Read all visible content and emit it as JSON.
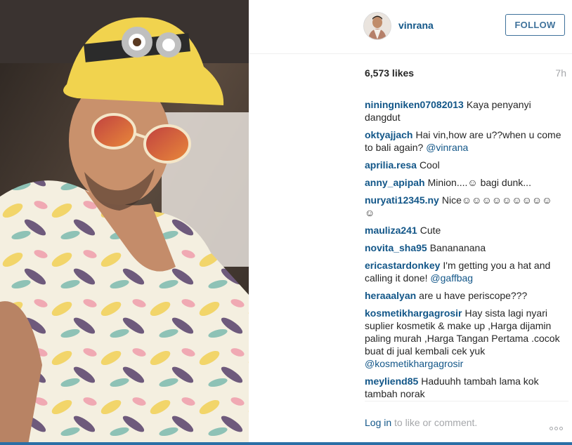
{
  "post": {
    "username": "vinrana",
    "follow_label": "FOLLOW",
    "likes": "6,573 likes",
    "time_ago": "7h",
    "photo_alt": "selfie"
  },
  "comments": [
    {
      "user": "niningniken07082013",
      "text": "Kaya penyanyi dangdut"
    },
    {
      "user": "oktyajjach",
      "text": "Hai vin,how are u??when u come to bali again?",
      "mention": "@vinrana"
    },
    {
      "user": "aprilia.resa",
      "text": "Cool"
    },
    {
      "user": "anny_apipah",
      "text": "Minion....☺ bagi dunk..."
    },
    {
      "user": "nuryati12345.ny",
      "text": "Nice☺☺☺☺☺☺☺☺☺ ☺"
    },
    {
      "user": "mauliza241",
      "text": "Cute"
    },
    {
      "user": "novita_sha95",
      "text": "Banananana"
    },
    {
      "user": "ericastardonkey",
      "text": "I'm getting you a hat and calling it done!",
      "mention": "@gaffbag"
    },
    {
      "user": "heraaalyan",
      "text": "are u have periscope???"
    },
    {
      "user": "kosmetikhargagrosir",
      "text": "Hay sista lagi nyari suplier kosmetik & make up ,Harga dijamin paling murah ,Harga Tangan Pertama .cocok buat di jual kembali cek yuk",
      "mention": "@kosmetikhargagrosir"
    },
    {
      "user": "meyliend85",
      "text": "Haduuhh tambah lama kok tambah norak"
    }
  ],
  "footer": {
    "login_link": "Log in",
    "login_rest": " to like or comment."
  },
  "icons": {
    "more": "more-options-icon",
    "avatar": "avatar"
  },
  "colors": {
    "username": "#125688",
    "follow_border": "#3f729b",
    "muted": "#a5a7aa"
  }
}
